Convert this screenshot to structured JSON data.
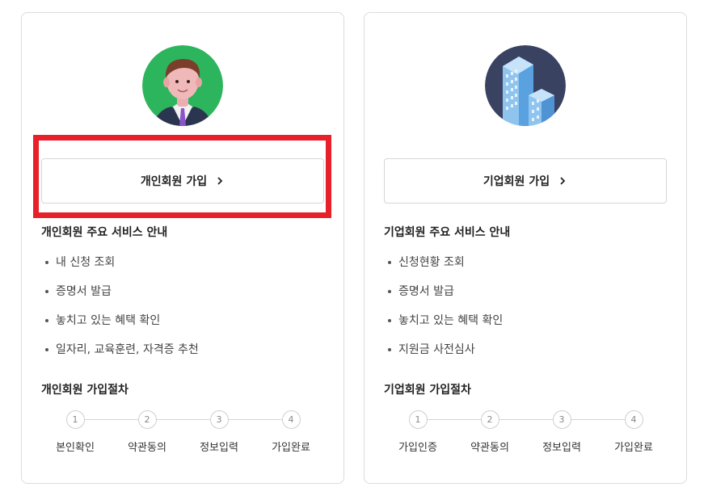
{
  "personal": {
    "join_label": "개인회원 가입",
    "service_title": "개인회원 주요 서비스 안내",
    "services": [
      "내 신청 조회",
      "증명서 발급",
      "놓치고 있는 혜택 확인",
      "일자리, 교육훈련, 자격증 추천"
    ],
    "process_title": "개인회원 가입절차",
    "steps": [
      {
        "num": "1",
        "label": "본인확인"
      },
      {
        "num": "2",
        "label": "약관동의"
      },
      {
        "num": "3",
        "label": "정보입력"
      },
      {
        "num": "4",
        "label": "가입완료"
      }
    ],
    "avatar_icon": "person-avatar-icon",
    "avatar_bg": "#2db55d"
  },
  "corporate": {
    "join_label": "기업회원 가입",
    "service_title": "기업회원 주요 서비스 안내",
    "services": [
      "신청현황 조회",
      "증명서 발급",
      "놓치고 있는 혜택 확인",
      "지원금 사전심사"
    ],
    "process_title": "기업회원 가입절차",
    "steps": [
      {
        "num": "1",
        "label": "가입인증"
      },
      {
        "num": "2",
        "label": "약관동의"
      },
      {
        "num": "3",
        "label": "정보입력"
      },
      {
        "num": "4",
        "label": "가입완료"
      }
    ],
    "avatar_icon": "building-icon",
    "avatar_bg": "#3a4262"
  },
  "highlight_color": "#e8202a"
}
